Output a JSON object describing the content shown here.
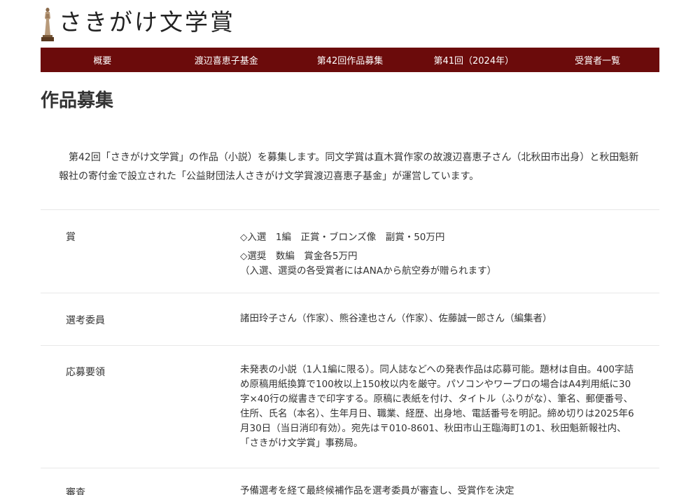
{
  "site": {
    "title": "さきがけ文学賞",
    "logo_icon": "bronze-statue-icon"
  },
  "nav": {
    "items": [
      {
        "label": "概要"
      },
      {
        "label": "渡辺喜恵子基金"
      },
      {
        "label": "第42回作品募集"
      },
      {
        "label": "第41回（2024年）"
      },
      {
        "label": "受賞者一覧"
      }
    ],
    "background_color": "#6b0b0b"
  },
  "page": {
    "title": "作品募集",
    "intro": "第42回「さきがけ文学賞」の作品（小説）を募集します。同文学賞は直木賞作家の故渡辺喜恵子さん（北秋田市出身）と秋田魁新報社の寄付金で設立された「公益財団法人さきがけ文学賞渡辺喜恵子基金」が運営しています。"
  },
  "details": {
    "prize": {
      "label": "賞",
      "line1": "◇入選　1編　正賞・ブロンズ像　副賞・50万円",
      "line2": "◇選奨　数編　賞金各5万円",
      "line3": "（入選、選奨の各受賞者にはANAから航空券が贈られます）"
    },
    "judges": {
      "label": "選考委員",
      "value": "諸田玲子さん（作家）、熊谷達也さん（作家）、佐藤誠一郎さん（編集者）"
    },
    "guidelines": {
      "label": "応募要領",
      "value": "未発表の小説（1人1編に限る）。同人誌などへの発表作品は応募可能。題材は自由。400字詰め原稿用紙換算で100枚以上150枚以内を厳守。パソコンやワープロの場合はA4判用紙に30字×40行の縦書きで印字する。原稿に表紙を付け、タイトル（ふりがな）、筆名、郵便番号、住所、氏名（本名）、生年月日、職業、経歴、出身地、電話番号を明記。締め切りは2025年6月30日（当日消印有効）。宛先は〒010-8601、秋田市山王臨海町1の1、秋田魁新報社内、「さきがけ文学賞」事務局。"
    },
    "review": {
      "label": "審査",
      "value": "予備選考を経て最終候補作品を選考委員が審査し、受賞作を決定"
    }
  }
}
